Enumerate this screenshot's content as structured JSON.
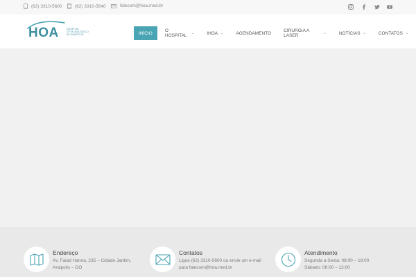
{
  "topbar": {
    "phone1": "(62) 3310-5600",
    "phone2": "(62) 3310-5640",
    "email": "falecom@hoa.med.br",
    "social": [
      "instagram-icon",
      "facebook-icon",
      "twitter-icon",
      "youtube-icon"
    ]
  },
  "logo": {
    "main": "HOA",
    "line1": "HOSPITAL",
    "line2": "OFTALMOLÓGICO",
    "line3": "DE ANÁPOLIS"
  },
  "nav": {
    "items": [
      {
        "label": "INÍCIO",
        "dropdown": false
      },
      {
        "label": "O HOSPITAL",
        "dropdown": true
      },
      {
        "label": "IHOA",
        "dropdown": true
      },
      {
        "label": "AGENDAMENTO",
        "dropdown": false
      },
      {
        "label": "CIRURGIA A LASER",
        "dropdown": true
      },
      {
        "label": "NOTÍCIAS",
        "dropdown": true
      },
      {
        "label": "CONTATOS",
        "dropdown": true
      }
    ],
    "chevron": "⌄"
  },
  "info": {
    "address": {
      "title": "Endereço",
      "line1": "Av. Faiad Hanna, 235 – Cidade Jardim,",
      "line2": "Anápolis – GO",
      "icon": "map-icon"
    },
    "contacts": {
      "title": "Contatos",
      "line1": "Ligue (62) 3310-5600 ou envie um e-mail",
      "line2": "para falecom@hoa.med.br",
      "icon": "envelope-icon"
    },
    "hours": {
      "title": "Atendimento",
      "line1": "Segunda a Sexta: 08:00 – 18:00",
      "line2": "Sábado: 08:00 – 12:00",
      "icon": "clock-icon"
    }
  },
  "colors": {
    "accent": "#49a4b3",
    "topbar_bg": "#f7f7f7",
    "slider_bg": "#f1f1f1",
    "footer_bg": "#e9e9e9"
  }
}
